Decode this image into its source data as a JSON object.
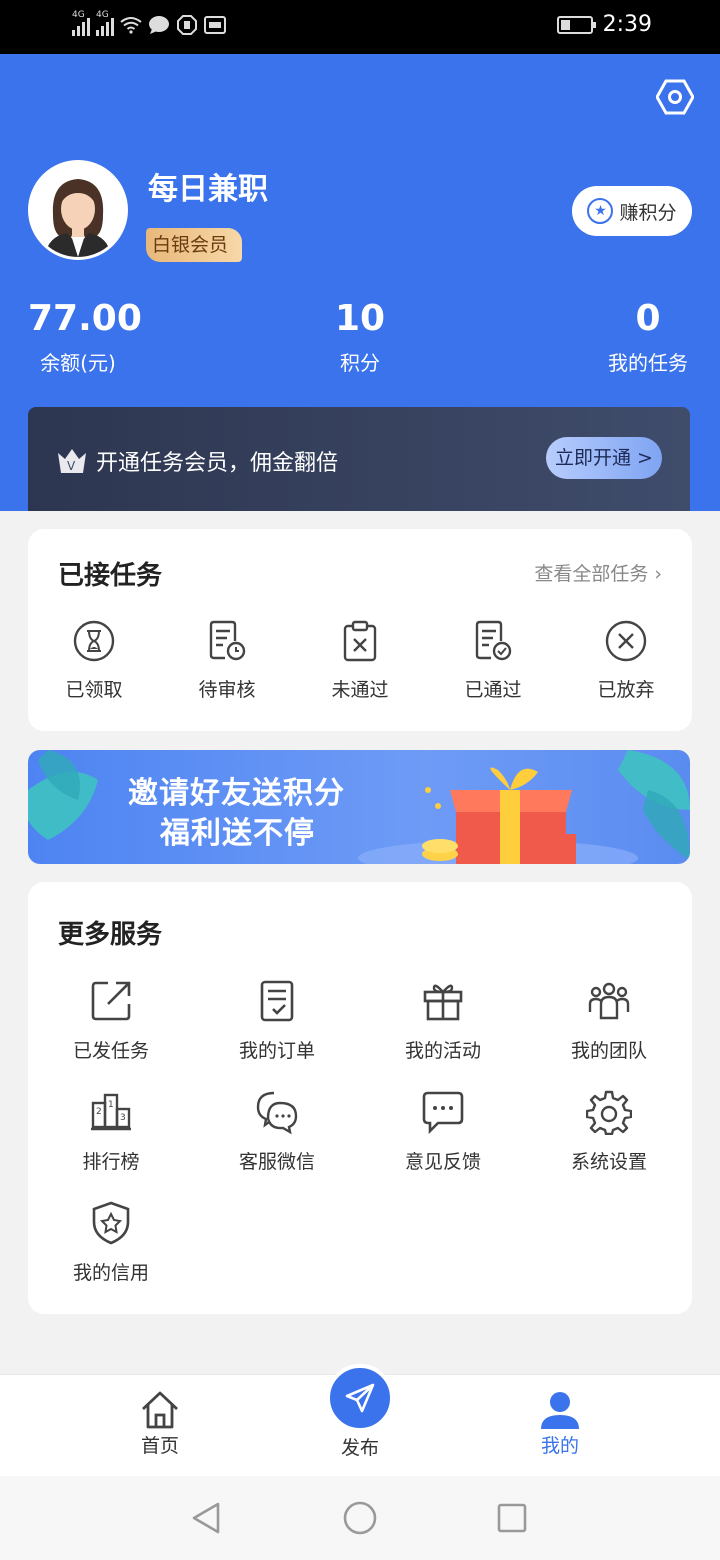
{
  "status_bar": {
    "signal_1": "4G",
    "signal_2": "4G",
    "time": "2:39"
  },
  "profile": {
    "name": "每日兼职",
    "member_level": "白银会员",
    "earn_points_label": "赚积分"
  },
  "stats": [
    {
      "value": "77.00",
      "label": "余额(元)"
    },
    {
      "value": "10",
      "label": "积分"
    },
    {
      "value": "0",
      "label": "我的任务"
    }
  ],
  "vip_banner": {
    "text": "开通任务会员，佣金翻倍",
    "button": "立即开通 >"
  },
  "tasks": {
    "title": "已接任务",
    "view_all": "查看全部任务",
    "items": [
      {
        "label": "已领取",
        "icon": "hourglass-icon"
      },
      {
        "label": "待审核",
        "icon": "pending-review-icon"
      },
      {
        "label": "未通过",
        "icon": "rejected-icon"
      },
      {
        "label": "已通过",
        "icon": "approved-icon"
      },
      {
        "label": "已放弃",
        "icon": "abandoned-icon"
      }
    ]
  },
  "promo": {
    "line1": "邀请好友送积分",
    "line2": "福利送不停"
  },
  "services": {
    "title": "更多服务",
    "items": [
      {
        "label": "已发任务",
        "icon": "external-link-icon"
      },
      {
        "label": "我的订单",
        "icon": "order-icon"
      },
      {
        "label": "我的活动",
        "icon": "gift-icon"
      },
      {
        "label": "我的团队",
        "icon": "team-icon"
      },
      {
        "label": "排行榜",
        "icon": "ranking-icon"
      },
      {
        "label": "客服微信",
        "icon": "chat-icon"
      },
      {
        "label": "意见反馈",
        "icon": "feedback-icon"
      },
      {
        "label": "系统设置",
        "icon": "gear-icon"
      },
      {
        "label": "我的信用",
        "icon": "shield-star-icon"
      }
    ]
  },
  "bottom_nav": {
    "items": [
      {
        "label": "首页",
        "icon": "home-icon"
      },
      {
        "label": "发布",
        "icon": "send-icon"
      },
      {
        "label": "我的",
        "icon": "user-icon"
      }
    ],
    "active_color": "#3a73ec"
  },
  "colors": {
    "primary": "#3a73ec",
    "vip_dark": "#2d3650"
  }
}
